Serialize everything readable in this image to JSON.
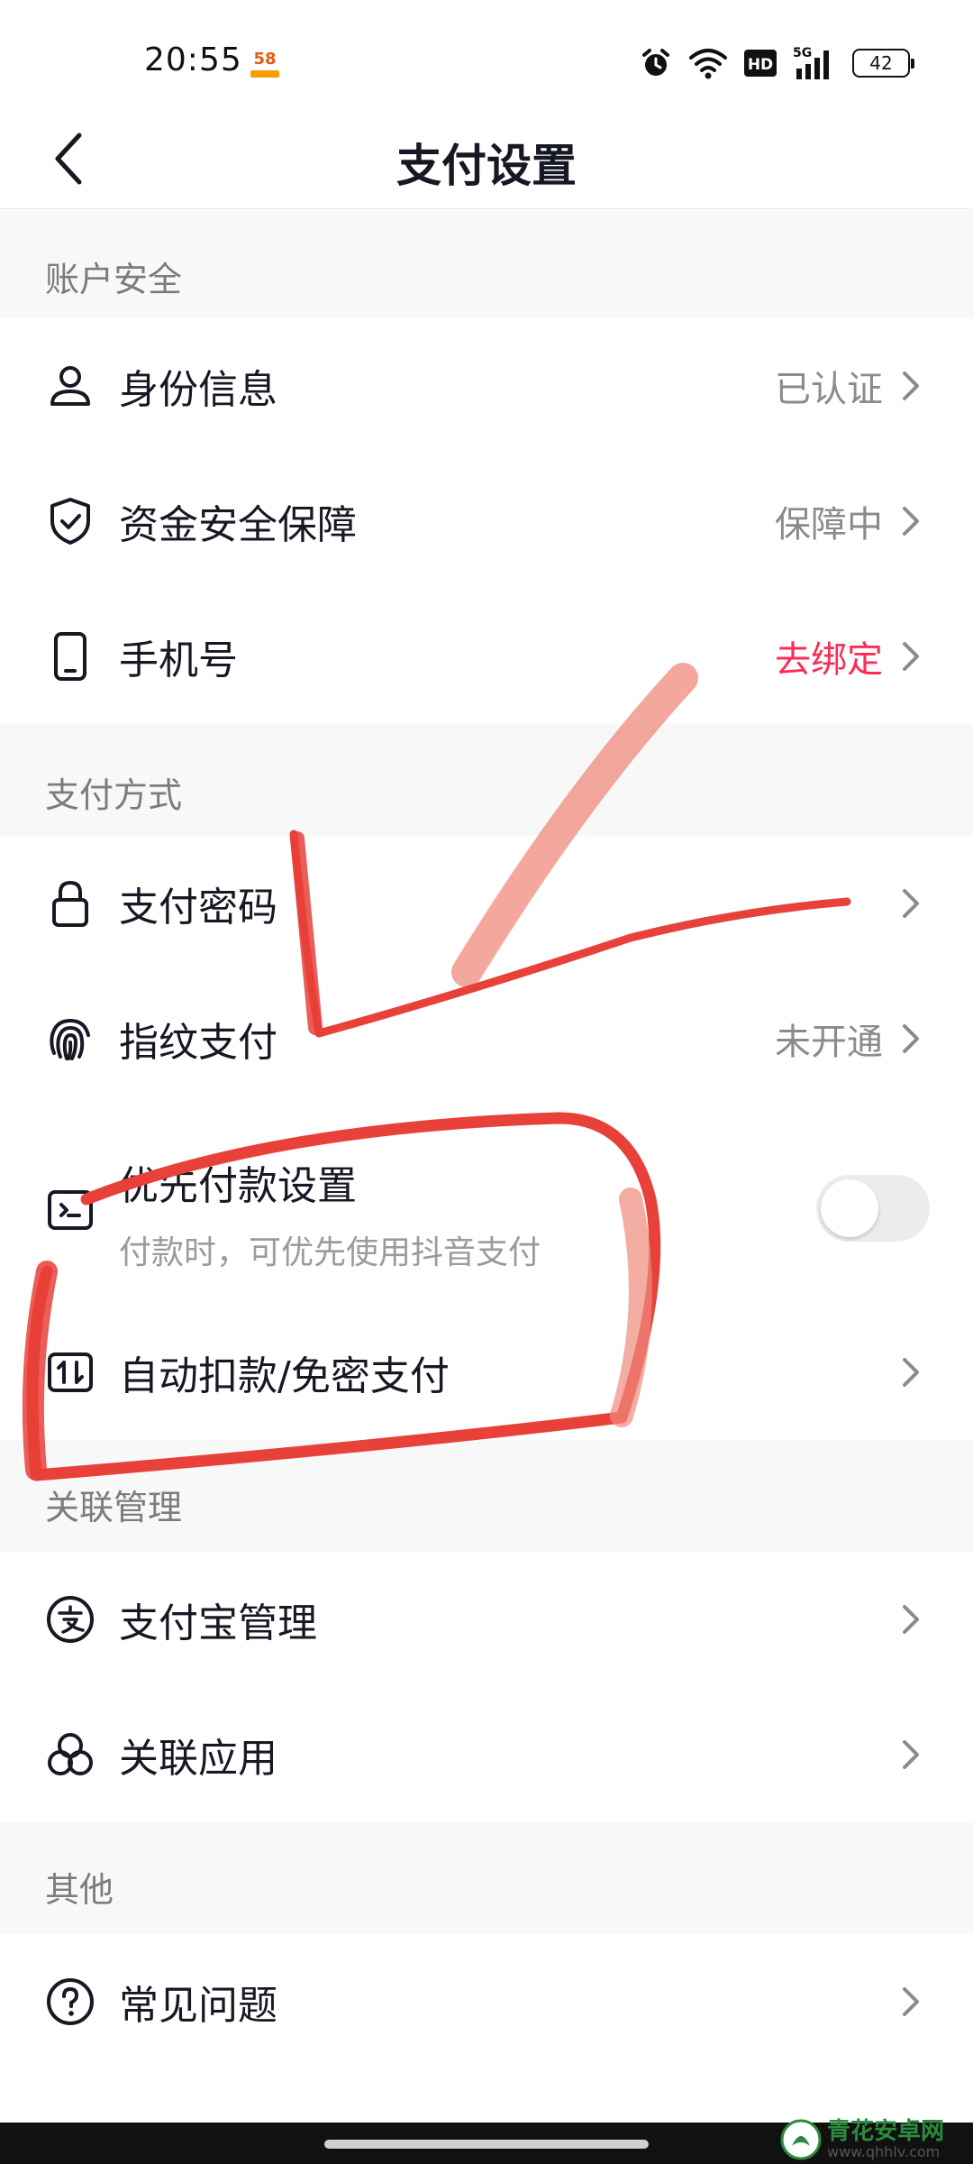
{
  "status_bar": {
    "time": "20:55",
    "app_icon_text": "58",
    "network": "5G",
    "hd": "HD",
    "battery": "42"
  },
  "header": {
    "title": "支付设置"
  },
  "sections": {
    "account_security": {
      "title": "账户安全",
      "identity": {
        "label": "身份信息",
        "status": "已认证"
      },
      "fund_security": {
        "label": "资金安全保障",
        "status": "保障中"
      },
      "phone": {
        "label": "手机号",
        "status": "去绑定",
        "status_color": "#fe2c55"
      }
    },
    "payment_methods": {
      "title": "支付方式",
      "password": {
        "label": "支付密码"
      },
      "fingerprint": {
        "label": "指纹支付",
        "status": "未开通"
      },
      "priority": {
        "label": "优先付款设置",
        "subtitle": "付款时，可优先使用抖音支付",
        "toggle_on": false
      },
      "auto_debit": {
        "label": "自动扣款/免密支付"
      }
    },
    "linked": {
      "title": "关联管理",
      "alipay": {
        "label": "支付宝管理"
      },
      "apps": {
        "label": "关联应用"
      }
    },
    "other": {
      "title": "其他",
      "faq": {
        "label": "常见问题"
      }
    }
  },
  "watermark": {
    "name": "青花安卓网",
    "url": "www.qhhlv.com"
  },
  "colors": {
    "accent_red": "#fe2c55",
    "annotation_red": "#e8413a",
    "section_bg": "#f8f8f8"
  }
}
